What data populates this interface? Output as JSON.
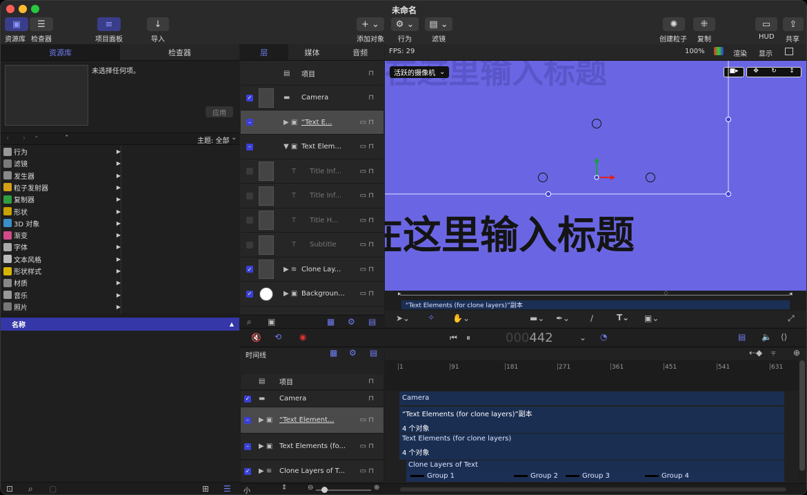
{
  "window": {
    "title": "未命名"
  },
  "toolbar": {
    "library": "资源库",
    "inspector": "检查器",
    "project_panel": "项目面板",
    "import": "导入",
    "add_object": "添加对象",
    "behaviors": "行为",
    "filters": "滤镜",
    "create_particles": "创建粒子",
    "replicate": "复制",
    "hud": "HUD",
    "share": "共享"
  },
  "left": {
    "tab_library": "资源库",
    "tab_inspector": "检查器",
    "no_selection": "未选择任何项。",
    "apply": "应用",
    "theme_label": "主题: 全部",
    "name_header": "名称",
    "items": [
      {
        "label": "行为",
        "color": "#999999"
      },
      {
        "label": "滤镜",
        "color": "#7a7a7a"
      },
      {
        "label": "发生器",
        "color": "#8a8a8a"
      },
      {
        "label": "粒子发射器",
        "color": "#d4a017"
      },
      {
        "label": "复制器",
        "color": "#2e9e3e"
      },
      {
        "label": "形状",
        "color": "#c8a200"
      },
      {
        "label": "3D 对象",
        "color": "#3a8fc8"
      },
      {
        "label": "渐变",
        "color": "#d04b8a"
      },
      {
        "label": "字体",
        "color": "#aaaaaa"
      },
      {
        "label": "文本风格",
        "color": "#bbbbbb"
      },
      {
        "label": "形状样式",
        "color": "#d8b400"
      },
      {
        "label": "材质",
        "color": "#888888"
      },
      {
        "label": "音乐",
        "color": "#999999"
      },
      {
        "label": "照片",
        "color": "#777777"
      }
    ]
  },
  "layers": {
    "tab_layers": "层",
    "tab_media": "媒体",
    "tab_audio": "音频",
    "rows": [
      {
        "name": "项目"
      },
      {
        "name": "Camera"
      },
      {
        "name": "“Text E..."
      },
      {
        "name": "Text Elem..."
      },
      {
        "name": "Title Inf..."
      },
      {
        "name": "Title Inf..."
      },
      {
        "name": "Title H..."
      },
      {
        "name": "Subtitle"
      },
      {
        "name": "Clone Lay..."
      },
      {
        "name": "Backgroun..."
      }
    ]
  },
  "canvas": {
    "fps": "FPS: 29",
    "zoom": "100%",
    "render": "渲染",
    "view": "显示",
    "camera_menu": "活跃的摄像机",
    "title_text": "在这里输入标题",
    "mini_label": "“Text Elements (for clone layers)”副本"
  },
  "transport": {
    "timecode_dim": "000",
    "timecode": "442"
  },
  "timeline": {
    "label": "时间线",
    "size_small": "小",
    "ruler": [
      "1",
      "91",
      "181",
      "271",
      "361",
      "451",
      "541",
      "631"
    ],
    "rows": [
      {
        "name": "项目"
      },
      {
        "name": "Camera"
      },
      {
        "name": "“Text Element..."
      },
      {
        "name": "Text Elements (fo..."
      },
      {
        "name": "Clone Layers of T..."
      }
    ],
    "bars": {
      "camera": "Camera",
      "copy": "“Text Elements (for clone layers)”副本",
      "count1": "4 个对象",
      "elements": "Text Elements (for clone layers)",
      "count2": "4 个对象",
      "clone": "Clone Layers of Text",
      "groups": [
        "Group 1",
        "Group 2",
        "Group 3",
        "Group 4"
      ]
    }
  }
}
